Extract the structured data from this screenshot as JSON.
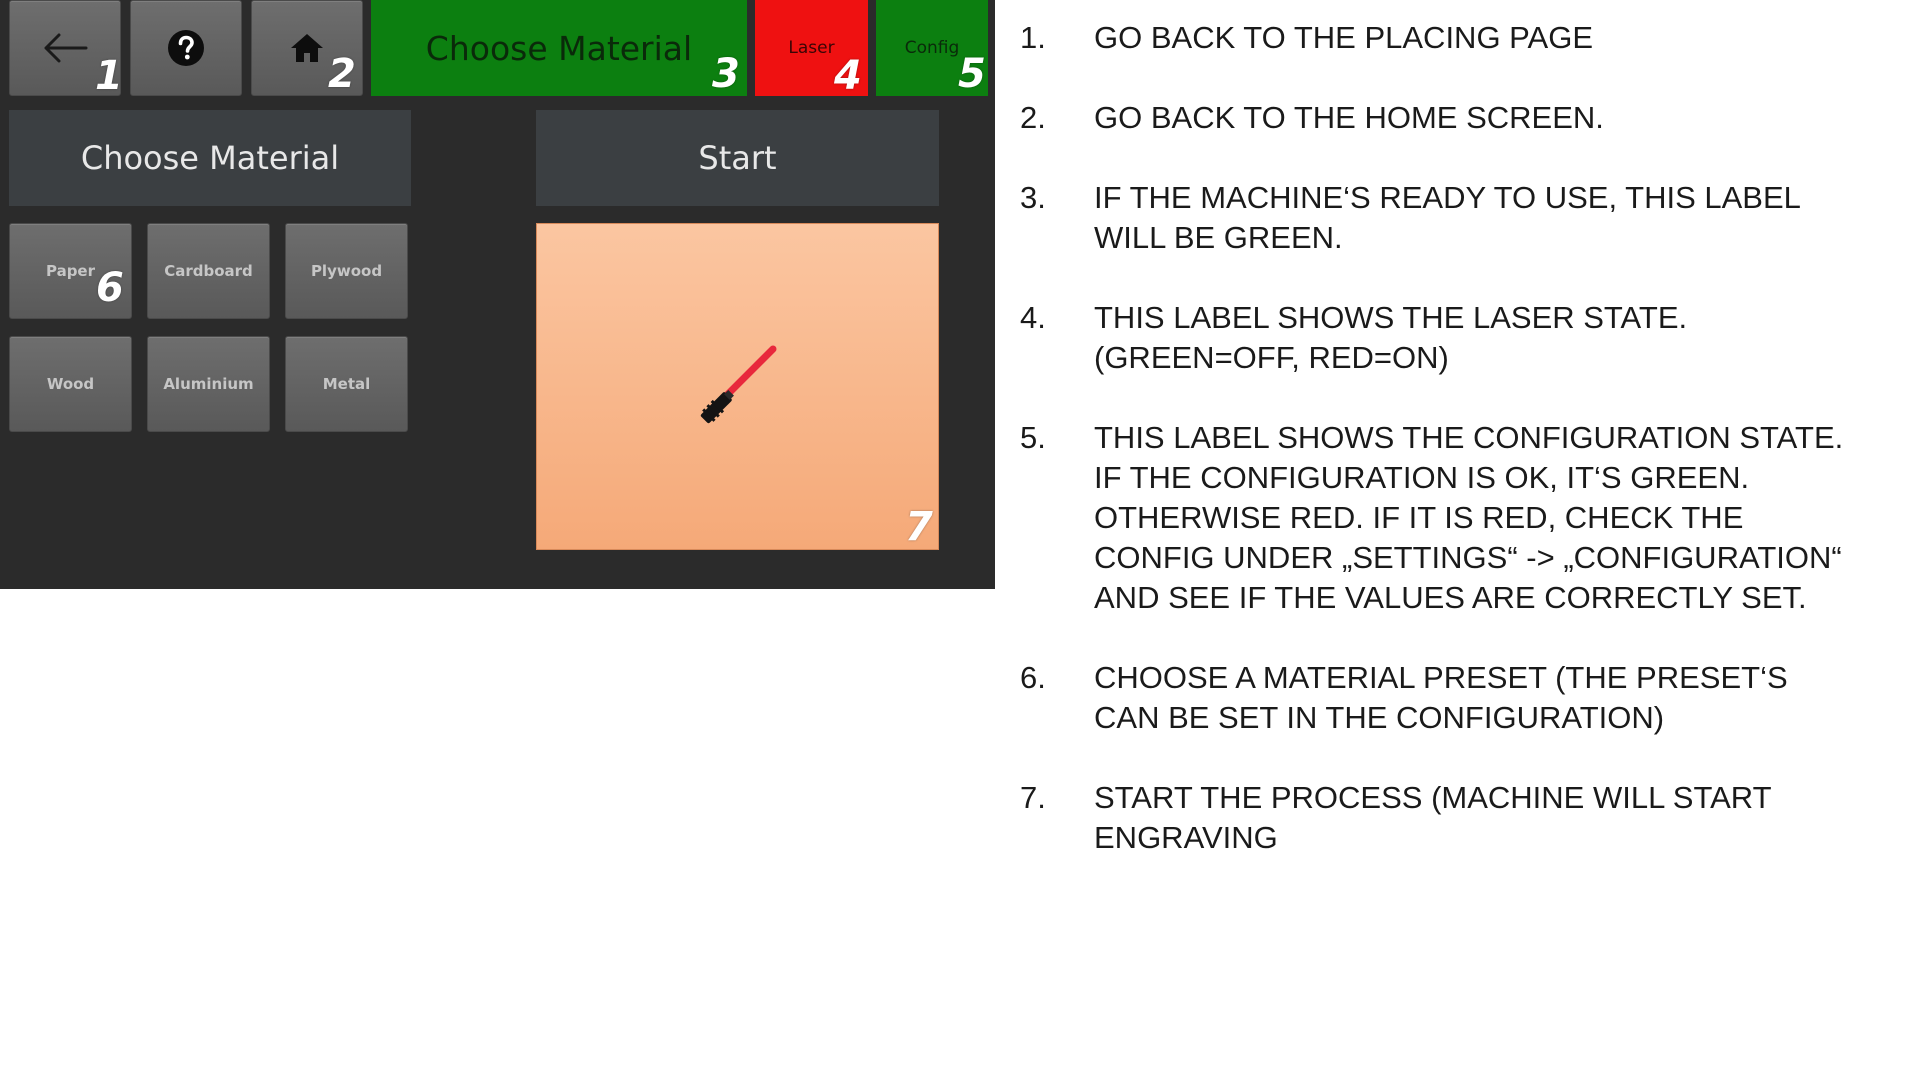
{
  "toolbar": {
    "back_icon": "arrow-left-icon",
    "help_icon": "question-circle-icon",
    "home_icon": "home-icon",
    "status_material": "Choose Material",
    "status_laser": "Laser",
    "status_config": "Config",
    "colors": {
      "material": "#0c7f10",
      "laser": "#ef1111",
      "config": "#0c7f10"
    }
  },
  "main": {
    "choose_title": "Choose Material",
    "start_title": "Start",
    "start_icon": "laser-pen-icon",
    "materials": [
      "Paper",
      "Cardboard",
      "Plywood",
      "Wood",
      "Aluminium",
      "Metal"
    ]
  },
  "callouts": [
    "1",
    "2",
    "3",
    "4",
    "5",
    "6",
    "7"
  ],
  "instructions": [
    {
      "index": "1.",
      "lines": [
        "GO BACK TO THE PLACING PAGE"
      ]
    },
    {
      "index": "2.",
      "lines": [
        "GO BACK TO THE HOME SCREEN."
      ]
    },
    {
      "index": "3.",
      "lines": [
        "IF THE MACHINE‘S READY TO USE, THIS LABEL",
        "WILL BE GREEN."
      ]
    },
    {
      "index": "4.",
      "lines": [
        "THIS LABEL SHOWS THE LASER STATE.",
        "(GREEN=OFF, RED=ON)"
      ]
    },
    {
      "index": "5.",
      "lines": [
        "THIS LABEL SHOWS THE CONFIGURATION STATE.",
        "IF THE CONFIGURATION IS OK, IT‘S GREEN.",
        "OTHERWISE RED. IF IT IS RED, CHECK THE",
        "CONFIG UNDER „SETTINGS“ -> „CONFIGURATION“",
        "AND SEE IF THE VALUES ARE CORRECTLY SET."
      ]
    },
    {
      "index": "6.",
      "lines": [
        "CHOOSE A MATERIAL PRESET (THE PRESET‘S",
        "CAN BE SET IN THE CONFIGURATION)"
      ]
    },
    {
      "index": "7.",
      "lines": [
        "START THE PROCESS (MACHINE WILL START",
        "ENGRAVING"
      ]
    }
  ]
}
